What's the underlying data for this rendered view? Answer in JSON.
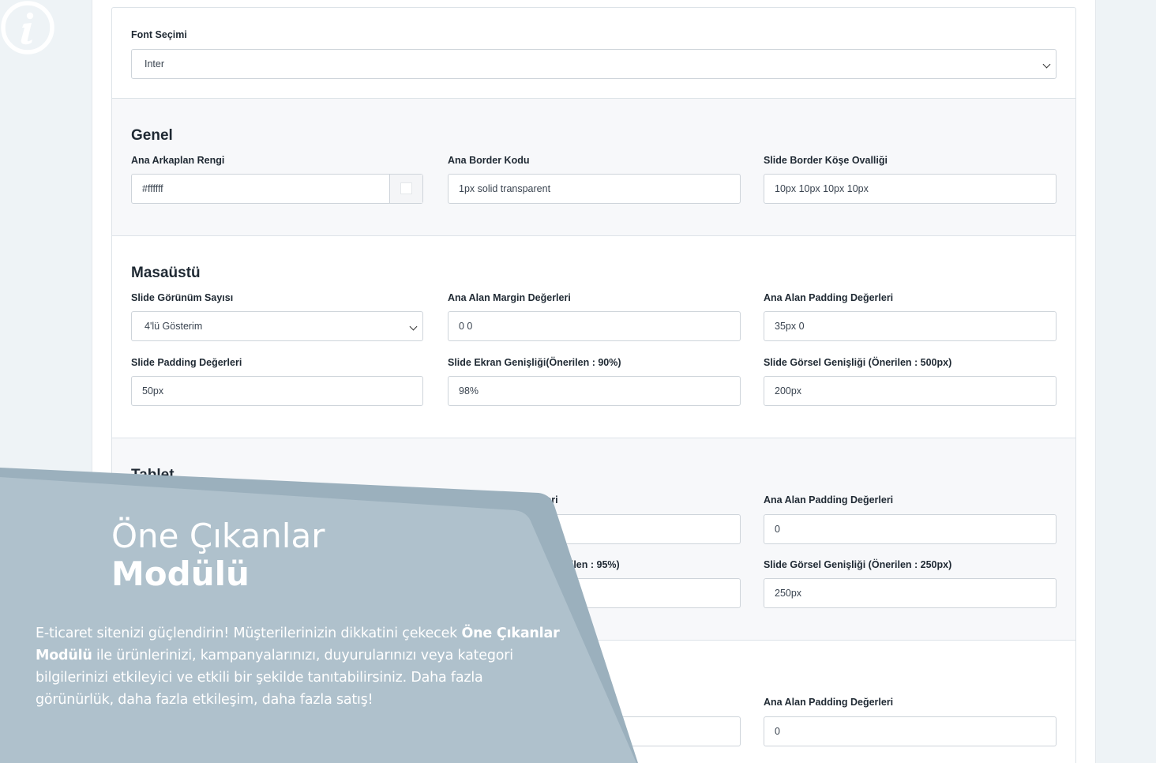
{
  "font_selection": {
    "label": "Font Seçimi",
    "value": "Inter"
  },
  "general": {
    "title": "Genel",
    "bg_color": {
      "label": "Ana Arkaplan Rengi",
      "value": "#ffffff"
    },
    "border_code": {
      "label": "Ana Border Kodu",
      "value": "1px solid transparent"
    },
    "border_radius": {
      "label": "Slide Border Köşe Ovalliği",
      "value": "10px 10px 10px 10px"
    }
  },
  "desktop": {
    "title": "Masaüstü",
    "slide_count": {
      "label": "Slide Görünüm Sayısı",
      "value": "4'lü Gösterim"
    },
    "margin": {
      "label": "Ana Alan Margin Değerleri",
      "value": "0 0"
    },
    "padding": {
      "label": "Ana Alan Padding Değerleri",
      "value": "35px 0"
    },
    "slide_padding": {
      "label": "Slide Padding Değerleri",
      "value": "50px"
    },
    "screen_width": {
      "label": "Slide Ekran Genişliği(Önerilen : 90%)",
      "value": "98%"
    },
    "image_width": {
      "label": "Slide Görsel Genişliği (Önerilen : 500px)",
      "value": "200px"
    }
  },
  "tablet": {
    "title": "Tablet",
    "margin_label_partial": "erleri",
    "padding": {
      "label": "Ana Alan Padding Değerleri",
      "value": "0"
    },
    "screen_width_label_partial": "rilen : 95%)",
    "image_width": {
      "label": "Slide Görsel Genişliği (Önerilen : 250px)",
      "value": "250px"
    }
  },
  "mobile": {
    "padding": {
      "label": "Ana Alan Padding Değerleri",
      "value": "0"
    }
  },
  "promo": {
    "title_line1": "Öne Çıkanlar",
    "title_line2": "Modülü",
    "text_1": "E-ticaret sitenizi güçlendirin! Müşterilerinizin dikkatini çekecek ",
    "text_bold_1": "Öne Çıkanlar Modülü",
    "text_2": " ile ürünlerinizi, kampanyalarınızı, duyurularınızı veya kategori bilgilerinizi etkileyici ve etkili bir şekilde tanıtabilirsiniz. Daha fazla görünürlük, daha fazla etkileşim, daha fazla satış!",
    "icon": "info-icon",
    "colors": {
      "panel": "#afc1cc",
      "panel_shadow": "#9bb0bd"
    }
  }
}
